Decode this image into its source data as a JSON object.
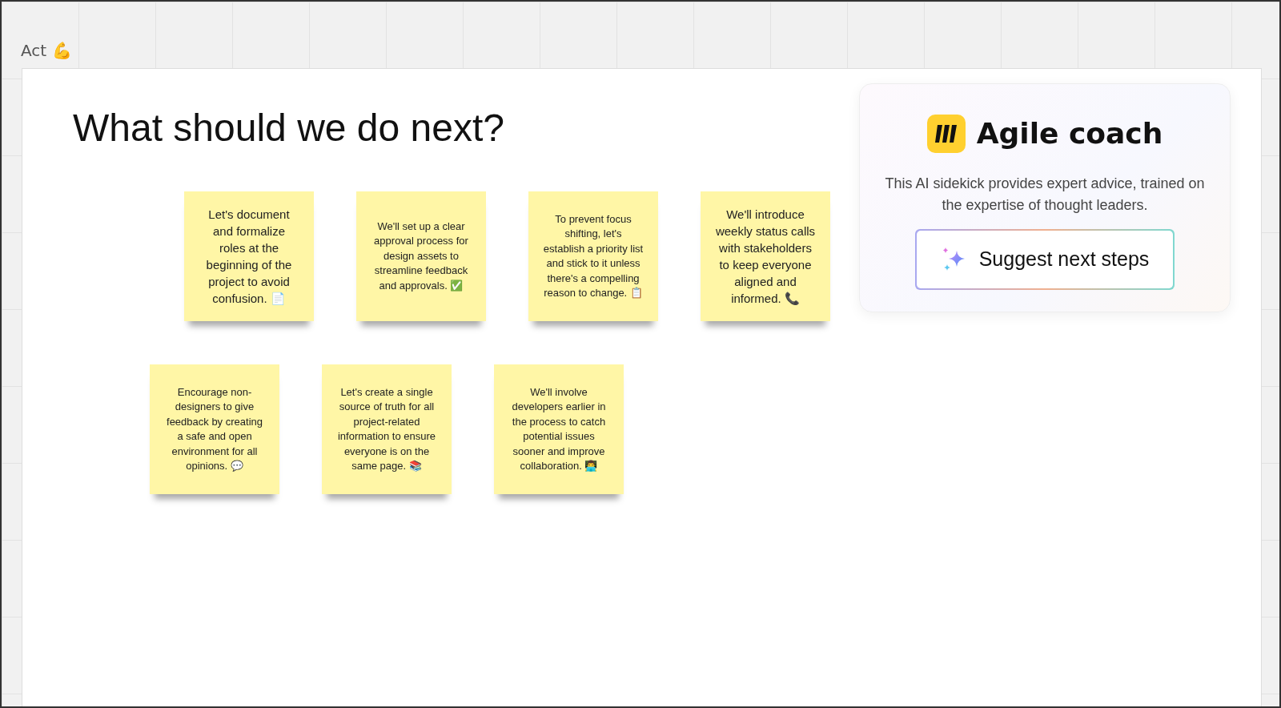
{
  "frame": {
    "label": "Act 💪"
  },
  "title": "What should we do next?",
  "sticky_notes": [
    {
      "text": "Let's document and formalize roles at the beginning of the project to avoid confusion. 📄",
      "kind": "large"
    },
    {
      "text": "We'll set up a clear approval process for design assets to streamline feedback and approvals. ✅",
      "kind": "small"
    },
    {
      "text": "To prevent focus shifting, let's establish a priority list and stick to it unless there's a compelling reason to change. 📋",
      "kind": "small"
    },
    {
      "text": "We'll introduce weekly status calls with stakeholders to keep everyone aligned and informed. 📞",
      "kind": "large"
    },
    {
      "text": "Encourage non-designers to give feedback by creating a safe and open environment for all opinions. 💬",
      "kind": "small"
    },
    {
      "text": "Let's create a single source of truth for all project-related information to ensure everyone is on the same page. 📚",
      "kind": "small"
    },
    {
      "text": "We'll involve developers earlier in the process to catch potential issues sooner and improve collaboration. 👨‍💻",
      "kind": "small"
    }
  ],
  "agile_coach": {
    "title": "Agile coach",
    "description": "This AI sidekick provides expert advice, trained on the expertise of thought leaders.",
    "button": "Suggest next steps"
  }
}
